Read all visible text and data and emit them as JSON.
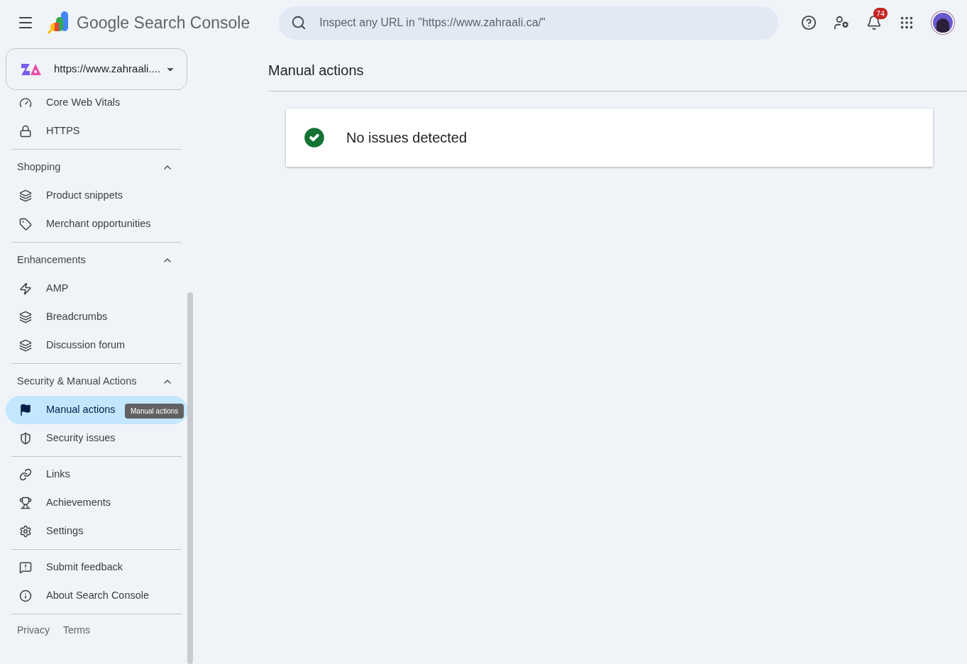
{
  "header": {
    "product": "Google Search Console",
    "search": {
      "placeholder": "Inspect any URL in \"https://www.zahraali.ca/\""
    },
    "notifications": "74"
  },
  "property": {
    "label": "https://www.zahraali...."
  },
  "sidebar": {
    "groups": [
      {
        "items": [
          {
            "label": "Core Web Vitals",
            "selected": false
          },
          {
            "label": "HTTPS",
            "selected": false
          }
        ]
      },
      {
        "title": "Shopping",
        "expanded": true,
        "items": [
          {
            "label": "Product snippets",
            "selected": false
          },
          {
            "label": "Merchant opportunities",
            "selected": false
          }
        ]
      },
      {
        "title": "Enhancements",
        "expanded": true,
        "items": [
          {
            "label": "AMP",
            "selected": false
          },
          {
            "label": "Breadcrumbs",
            "selected": false
          },
          {
            "label": "Discussion forum",
            "selected": false
          }
        ]
      },
      {
        "title": "Security & Manual Actions",
        "expanded": true,
        "items": [
          {
            "label": "Manual actions",
            "selected": true,
            "tooltip": "Manual actions"
          },
          {
            "label": "Security issues",
            "selected": false
          }
        ]
      },
      {
        "items": [
          {
            "label": "Links",
            "selected": false
          },
          {
            "label": "Achievements",
            "selected": false
          },
          {
            "label": "Settings",
            "selected": false
          }
        ]
      },
      {
        "items": [
          {
            "label": "Submit feedback",
            "selected": false
          },
          {
            "label": "About Search Console",
            "selected": false
          }
        ]
      }
    ],
    "footer": [
      "Privacy",
      "Terms"
    ]
  },
  "page": {
    "title": "Manual actions",
    "status": {
      "kind": "ok",
      "message": "No issues detected"
    }
  }
}
